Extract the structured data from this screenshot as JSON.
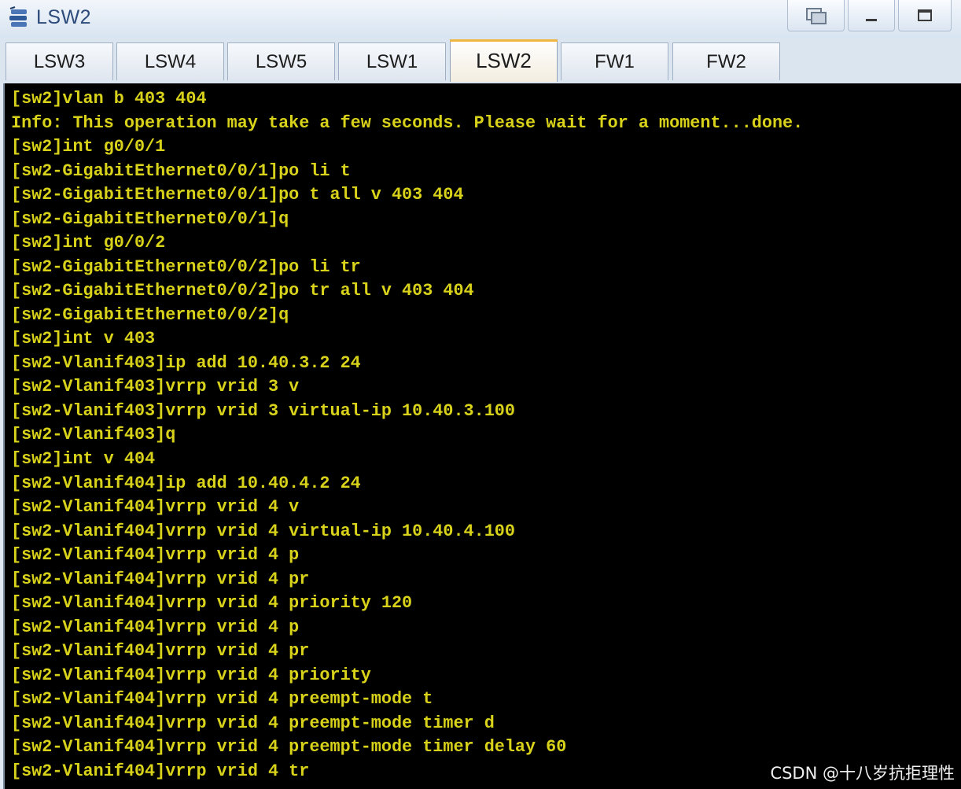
{
  "window": {
    "title": "LSW2",
    "icon": "switch-icon"
  },
  "tabs": [
    {
      "label": "LSW3",
      "active": false
    },
    {
      "label": "LSW4",
      "active": false
    },
    {
      "label": "LSW5",
      "active": false
    },
    {
      "label": "LSW1",
      "active": false
    },
    {
      "label": "LSW2",
      "active": true
    },
    {
      "label": "FW1",
      "active": false
    },
    {
      "label": "FW2",
      "active": false
    }
  ],
  "terminal": {
    "text_color": "#d9d21a",
    "background": "#000000",
    "lines": [
      "[sw2]vlan b 403 404",
      "Info: This operation may take a few seconds. Please wait for a moment...done.",
      "[sw2]int g0/0/1",
      "[sw2-GigabitEthernet0/0/1]po li t",
      "[sw2-GigabitEthernet0/0/1]po t all v 403 404",
      "[sw2-GigabitEthernet0/0/1]q",
      "[sw2]int g0/0/2",
      "[sw2-GigabitEthernet0/0/2]po li tr",
      "[sw2-GigabitEthernet0/0/2]po tr all v 403 404",
      "[sw2-GigabitEthernet0/0/2]q",
      "[sw2]int v 403",
      "[sw2-Vlanif403]ip add 10.40.3.2 24",
      "[sw2-Vlanif403]vrrp vrid 3 v",
      "[sw2-Vlanif403]vrrp vrid 3 virtual-ip 10.40.3.100",
      "[sw2-Vlanif403]q",
      "[sw2]int v 404",
      "[sw2-Vlanif404]ip add 10.40.4.2 24",
      "[sw2-Vlanif404]vrrp vrid 4 v",
      "[sw2-Vlanif404]vrrp vrid 4 virtual-ip 10.40.4.100",
      "[sw2-Vlanif404]vrrp vrid 4 p",
      "[sw2-Vlanif404]vrrp vrid 4 pr",
      "[sw2-Vlanif404]vrrp vrid 4 priority 120",
      "[sw2-Vlanif404]vrrp vrid 4 p",
      "[sw2-Vlanif404]vrrp vrid 4 pr",
      "[sw2-Vlanif404]vrrp vrid 4 priority",
      "[sw2-Vlanif404]vrrp vrid 4 preempt-mode t",
      "[sw2-Vlanif404]vrrp vrid 4 preempt-mode timer d",
      "[sw2-Vlanif404]vrrp vrid 4 preempt-mode timer delay 60",
      "[sw2-Vlanif404]vrrp vrid 4 tr"
    ]
  },
  "watermark": "CSDN @十八岁抗拒理性"
}
